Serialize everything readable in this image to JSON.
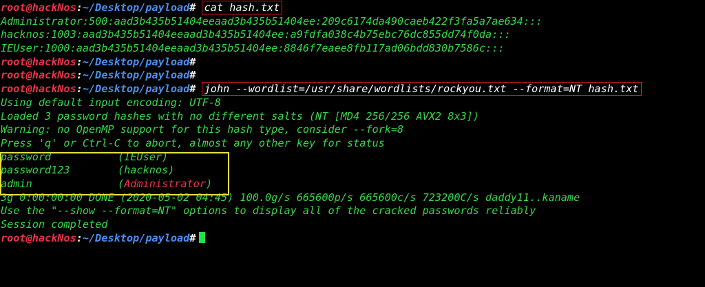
{
  "prompt": {
    "user": "root@hackNos",
    "sep": ":",
    "path": "~/Desktop/payload",
    "symbol": "#"
  },
  "lines": [
    {
      "type": "prompt",
      "cmd": "cat hash.txt",
      "boxed": true
    },
    {
      "type": "out",
      "text": "Administrator:500:aad3b435b51404eeaad3b435b51404ee:209c6174da490caeb422f3fa5a7ae634:::"
    },
    {
      "type": "out",
      "text": "hacknos:1003:aad3b435b51404eeaad3b435b51404ee:a9fdfa038c4b75ebc76dc855dd74f0da:::"
    },
    {
      "type": "out",
      "text": "IEUser:1000:aad3b435b51404eeaad3b435b51404ee:8846f7eaee8fb117ad06bdd830b7586c:::"
    },
    {
      "type": "prompt",
      "cmd": "",
      "boxed": false
    },
    {
      "type": "prompt",
      "cmd": "",
      "boxed": false
    },
    {
      "type": "prompt",
      "cmd": "john --wordlist=/usr/share/wordlists/rockyou.txt --format=NT hash.txt",
      "boxed": true
    },
    {
      "type": "out",
      "text": "Using default input encoding: UTF-8"
    },
    {
      "type": "out",
      "text": "Loaded 3 password hashes with no different salts (NT [MD4 256/256 AVX2 8x3])"
    },
    {
      "type": "out",
      "text": "Warning: no OpenMP support for this hash type, consider --fork=8"
    },
    {
      "type": "out",
      "text": "Press 'q' or Ctrl-C to abort, almost any other key for status"
    },
    {
      "type": "cracked",
      "password": "password",
      "account": "(IEUser)",
      "red": false
    },
    {
      "type": "cracked",
      "password": "password123",
      "account": "(hacknos)",
      "red": false
    },
    {
      "type": "cracked",
      "password": "admin",
      "account": "(Administrator)",
      "red": true
    },
    {
      "type": "out",
      "text": "3g 0:00:00:00 DONE (2020-05-02 04:45) 100.0g/s 665600p/s 665600c/s 723200C/s daddy11..kaname"
    },
    {
      "type": "out",
      "text": "Use the \"--show --format=NT\" options to display all of the cracked passwords reliably"
    },
    {
      "type": "out",
      "text": "Session completed"
    },
    {
      "type": "prompt",
      "cmd": "",
      "boxed": false,
      "cursor": true
    }
  ],
  "colors": {
    "background": "#000000",
    "prompt_user": "#e8344a",
    "prompt_path": "#4a8ff0",
    "output_text": "#34d64a",
    "command_text": "#ffffff",
    "highlight_red_box": "#e0202a",
    "highlight_yellow_box": "#e6e03a",
    "cursor": "#22e04a"
  }
}
